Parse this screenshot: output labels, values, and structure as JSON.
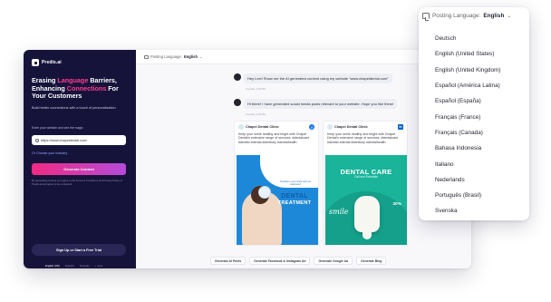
{
  "app": {
    "logo_text": "Predis.ai"
  },
  "left_panel": {
    "headline_part1": "Erasing ",
    "headline_highlight1": "Language",
    "headline_part2": " Barriers, Enhancing ",
    "headline_highlight2": "Connections",
    "headline_part3": " For Your Customers",
    "subline": "Build better connections with a touch of personalization",
    "field_label": "Enter your website and see the magic",
    "url_value": "https://www.chapeldental.com/",
    "choose_industry": "Or Choose your Industry",
    "generate_button": "Generate Content",
    "terms_text": "By generating content you agree to the Terms & Conditions and Privacy Policy of Predis.ai and agree to be contacted.",
    "signup_button": "Sign Up or Start a Free Trial",
    "footer_links": [
      "English (US)",
      "Español",
      "Français",
      "+ more"
    ]
  },
  "topbar": {
    "posting_label": "Posting Language:",
    "posting_value": "English",
    "right_text": "Abo"
  },
  "chat": {
    "user_message": "Hey Lexi! Show me the AI generated content using my website \"www.chapeldental.com\"",
    "user_time": "Tuesday 4:18 PM",
    "bot_message": "Hi there! I have generated social media posts relevant to your website. Hope you like them!",
    "bot_time": "Tuesday 4:18 PM"
  },
  "cards": [
    {
      "clinic_name": "Chapel Dental Clinic",
      "network_icon": "facebook-icon",
      "text": "Keep your smile healthy and bright with Chapel Dental's extensive range of services. #dentalcare #dentist #dental #dentistry #dentalhealth",
      "small_text": "Transform your smile with our advanced",
      "big_word": "DENTAL",
      "big_word2": "TREATMENT"
    },
    {
      "clinic_name": "Chapel Dental Clinic",
      "network_icon": "linkedin-icon",
      "text": "Keep your smile healthy and bright with Chapel Dental's extensive range of services. #dentalcare #dentist #dental #dentistry #dentalhealth",
      "big_word": "DENTAL CARE",
      "sub": "Call and Schedule",
      "script_word": "smile",
      "off": "30%"
    }
  ],
  "chips": [
    "Generate AI Posts",
    "Generate Facebook & Instagram Ad",
    "Generate Google Ad",
    "Generate Blog"
  ],
  "dropdown": {
    "label": "Posting Language:",
    "value": "English",
    "icon": "translate-icon",
    "options": [
      "Deutsch",
      "English (United States)",
      "English (United Kingdom)",
      "Español (América Latina)",
      "Español (España)",
      "Français (France)",
      "Français (Canada)",
      "Bahasa Indonesia",
      "Italiano",
      "Nederlands",
      "Português (Brasil)",
      "Svenska"
    ]
  },
  "colors": {
    "sidebar": "#16133b",
    "accent_pink": "#ff3b8d",
    "button_gradient_start": "#f02a83",
    "button_gradient_end": "#b54bd8",
    "facebook": "#1877f2",
    "linkedin": "#0a66c2"
  }
}
